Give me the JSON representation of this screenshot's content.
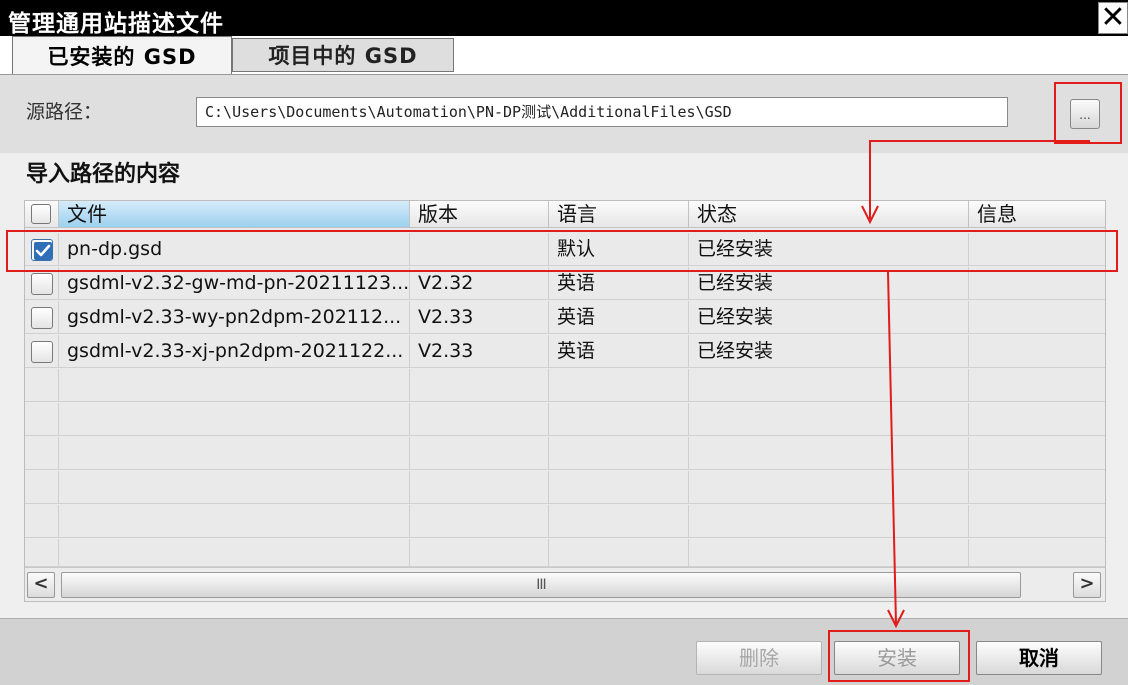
{
  "window": {
    "title": "管理通用站描述文件",
    "close_glyph": "✕"
  },
  "tabs": [
    {
      "label": "已安装的 GSD",
      "active": true
    },
    {
      "label": "项目中的 GSD",
      "active": false
    }
  ],
  "source": {
    "label": "源路径：",
    "path": "C:\\Users\\Documents\\Automation\\PN-DP测试\\AdditionalFiles\\GSD",
    "browse_label": "..."
  },
  "section_title": "导入路径的内容",
  "table": {
    "columns": [
      "文件",
      "版本",
      "语言",
      "状态",
      "信息"
    ],
    "rows": [
      {
        "checked": true,
        "file": "pn-dp.gsd",
        "version": "",
        "language": "默认",
        "status": "已经安装",
        "info": ""
      },
      {
        "checked": false,
        "file": "gsdml-v2.32-gw-md-pn-20211123...",
        "version": "V2.32",
        "language": "英语",
        "status": "已经安装",
        "info": ""
      },
      {
        "checked": false,
        "file": "gsdml-v2.33-wy-pn2dpm-202112...",
        "version": "V2.33",
        "language": "英语",
        "status": "已经安装",
        "info": ""
      },
      {
        "checked": false,
        "file": "gsdml-v2.33-xj-pn2dpm-2021122...",
        "version": "V2.33",
        "language": "英语",
        "status": "已经安装",
        "info": ""
      }
    ],
    "scroll": {
      "left": "<",
      "right": ">",
      "thumb": "III"
    }
  },
  "buttons": {
    "delete": "删除",
    "install": "安装",
    "cancel": "取消"
  },
  "annotation_color": "#e21b1b"
}
